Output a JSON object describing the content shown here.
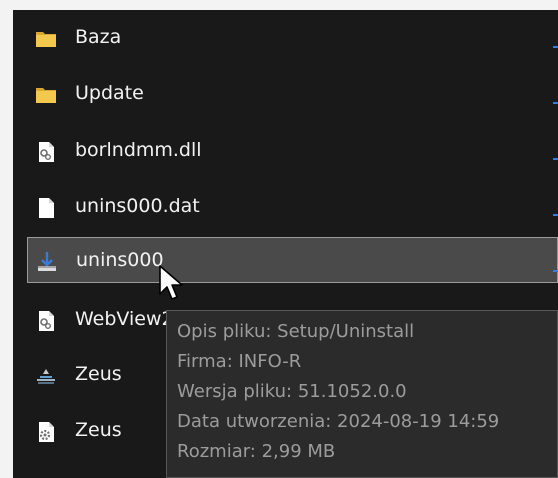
{
  "files": [
    {
      "name": "Baza",
      "icon": "folder-icon"
    },
    {
      "name": "Update",
      "icon": "folder-icon"
    },
    {
      "name": "borlndmm.dll",
      "icon": "dll-file-icon"
    },
    {
      "name": "unins000.dat",
      "icon": "blank-file-icon"
    },
    {
      "name": "unins000",
      "icon": "installer-icon",
      "selected": true
    },
    {
      "name": "WebView2Loader.dll",
      "icon": "dll-file-icon"
    },
    {
      "name": "Zeus",
      "icon": "zeus-app-icon"
    },
    {
      "name": "Zeus",
      "icon": "settings-file-icon"
    }
  ],
  "tooltip": {
    "description": "Opis pliku: Setup/Uninstall",
    "company": "Firma: INFO-R",
    "version": "Wersja pliku: 51.1052.0.0",
    "created": "Data utworzenia: 2024-08-19 14:59",
    "size": "Rozmiar: 2,99 MB"
  },
  "colors": {
    "background": "#191919",
    "text": "#f2f2f2",
    "selection": "#4a4a4a",
    "folder": "#f2c94c",
    "accent": "#3a7bd5",
    "tooltip_text": "#9c9c9c"
  }
}
